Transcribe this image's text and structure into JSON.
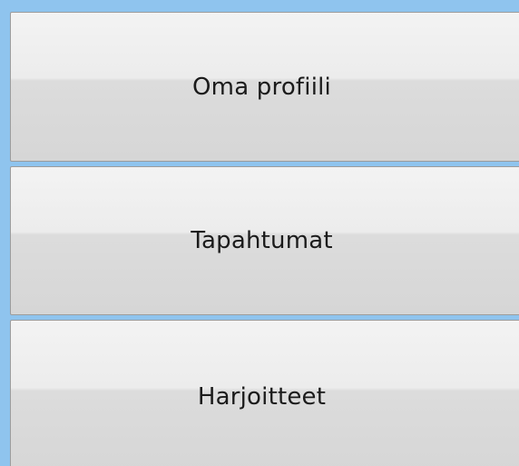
{
  "menu": {
    "items": [
      {
        "label": "Oma profiili"
      },
      {
        "label": "Tapahtumat"
      },
      {
        "label": "Harjoitteet"
      }
    ]
  },
  "colors": {
    "panel_background": "#8fc4ee",
    "button_top": "#f3f3f3",
    "button_bottom": "#d6d6d6",
    "button_border": "#9c9c9c",
    "text": "#1b1b1b"
  }
}
